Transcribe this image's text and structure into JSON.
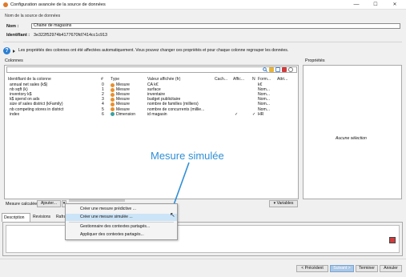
{
  "window": {
    "title": "Configuration avancée de la source de données",
    "controls": {
      "minimize": "—",
      "maximize": "☐",
      "close": "✕"
    }
  },
  "source": {
    "section_label": "Nom de la source de données",
    "name_label": "Nom :",
    "name_value": "Chaine de magasins",
    "id_label": "Identifiant :",
    "id_value": "3e322f52974b4177670fd7414cc1c913"
  },
  "info": {
    "icon": "question-icon",
    "text": "Les propriétés des colonnes ont été affectées automatiquement. Vous pouvez changer ces propriétés et pour chaque colonne regrouper les données."
  },
  "columns_panel": {
    "title": "Colonnes",
    "headers": [
      "Identifiant de la colonne",
      "#",
      "Type",
      "Valeur affichée (fr)",
      "Cach...",
      "Affic...",
      "N",
      "Form...",
      "Attri..."
    ],
    "rows": [
      {
        "id": "annual net sales (k$)",
        "num": "0",
        "type": "Mesure",
        "color": "#e8902f",
        "display": "CA k€",
        "cach": "",
        "affic": "",
        "n": "",
        "form": "k€"
      },
      {
        "id": "nb sqft (k)",
        "num": "1",
        "type": "Mesure",
        "color": "#e8902f",
        "display": "surface",
        "cach": "",
        "affic": "",
        "n": "",
        "form": "Nom..."
      },
      {
        "id": "inventory k$",
        "num": "2",
        "type": "Mesure",
        "color": "#e8902f",
        "display": "inventaire",
        "cach": "",
        "affic": "",
        "n": "",
        "form": "Nom..."
      },
      {
        "id": "k$ spend on ads",
        "num": "3",
        "type": "Mesure",
        "color": "#e8902f",
        "display": "budget publicitaire",
        "cach": "",
        "affic": "",
        "n": "",
        "form": "Nom..."
      },
      {
        "id": "size of sales district (kFamily)",
        "num": "4",
        "type": "Mesure",
        "color": "#e8902f",
        "display": "nombre de familles (milliers)",
        "cach": "",
        "affic": "",
        "n": "",
        "form": "Nom..."
      },
      {
        "id": "nb competing stores in district",
        "num": "5",
        "type": "Mesure",
        "color": "#e8902f",
        "display": "nombre de concurrents (millie...",
        "cach": "",
        "affic": "",
        "n": "",
        "form": "Nom..."
      },
      {
        "id": "index",
        "num": "6",
        "type": "Dimension",
        "color": "#3aa0a0",
        "display": "id magasin",
        "cach": "",
        "affic": "✓",
        "n": "✓",
        "form": "HR"
      }
    ]
  },
  "properties_panel": {
    "title": "Propriétés",
    "empty_text": "Aucune sélection"
  },
  "bottom_bar": {
    "measure_label": "Mesure calculée:",
    "add_button": "Ajouter...",
    "variables_button": "Variables"
  },
  "menu": {
    "items": [
      "Créer une mesure prédictive ...",
      "Créer une mesure simulée ...",
      "Gestionnaire des contextes partagés...",
      "Appliquer des contextes partagés..."
    ]
  },
  "tabs": [
    "Description",
    "Revisions",
    "Rafra"
  ],
  "footer": {
    "prev": "< Précédent",
    "next": "Suivant >",
    "finish": "Terminer",
    "cancel": "Annuler"
  },
  "annotation": {
    "text": "Mesure simulée",
    "color": "#2f8fd6"
  },
  "colors": {
    "measure_dot": "#e8902f",
    "dimension_dot": "#3aa0a0",
    "menu_highlight": "#cce4f7",
    "accent": "#2a7fd4"
  }
}
